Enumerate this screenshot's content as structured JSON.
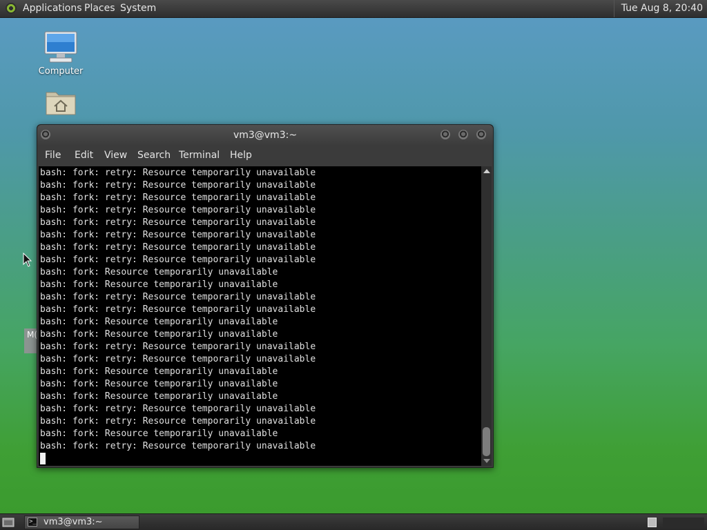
{
  "top_panel": {
    "menus": [
      "Applications",
      "Places",
      "System"
    ],
    "clock": "Tue Aug  8, 20:40"
  },
  "desktop": {
    "icons": [
      {
        "label": "Computer",
        "icon": "computer-icon"
      },
      {
        "label": "",
        "icon": "home-folder-icon"
      }
    ],
    "partial_icon_label": "M("
  },
  "terminal": {
    "title": "vm3@vm3:~",
    "menus": [
      "File",
      "Edit",
      "View",
      "Search",
      "Terminal",
      "Help"
    ],
    "lines": [
      "bash: fork: retry: Resource temporarily unavailable",
      "bash: fork: retry: Resource temporarily unavailable",
      "bash: fork: retry: Resource temporarily unavailable",
      "bash: fork: retry: Resource temporarily unavailable",
      "bash: fork: retry: Resource temporarily unavailable",
      "bash: fork: retry: Resource temporarily unavailable",
      "bash: fork: retry: Resource temporarily unavailable",
      "bash: fork: retry: Resource temporarily unavailable",
      "bash: fork: Resource temporarily unavailable",
      "bash: fork: Resource temporarily unavailable",
      "bash: fork: retry: Resource temporarily unavailable",
      "bash: fork: retry: Resource temporarily unavailable",
      "bash: fork: Resource temporarily unavailable",
      "bash: fork: Resource temporarily unavailable",
      "bash: fork: retry: Resource temporarily unavailable",
      "bash: fork: retry: Resource temporarily unavailable",
      "bash: fork: Resource temporarily unavailable",
      "bash: fork: Resource temporarily unavailable",
      "bash: fork: Resource temporarily unavailable",
      "bash: fork: retry: Resource temporarily unavailable",
      "bash: fork: retry: Resource temporarily unavailable",
      "bash: fork: Resource temporarily unavailable",
      "bash: fork: retry: Resource temporarily unavailable"
    ]
  },
  "taskbar": {
    "window_button_label": "vm3@vm3:~"
  },
  "colors": {
    "panel": "#2e2e2e",
    "terminal_bg": "#000000",
    "terminal_fg": "#e0e0e0",
    "desktop_top": "#5b9bc4",
    "desktop_bottom": "#3a9a2c"
  }
}
